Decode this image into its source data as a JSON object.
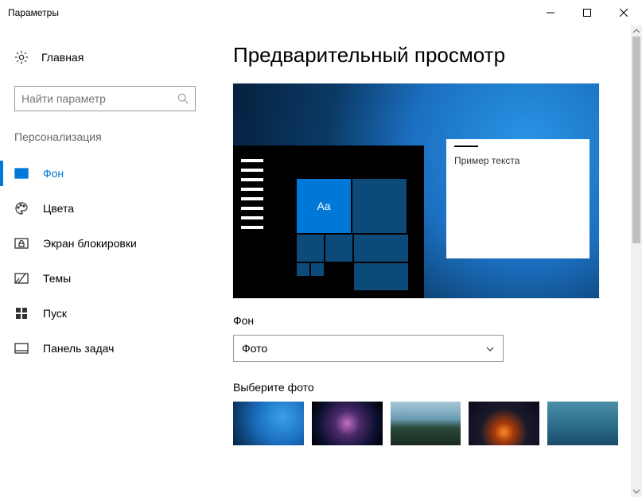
{
  "titlebar": {
    "title": "Параметры"
  },
  "sidebar": {
    "home": "Главная",
    "search_placeholder": "Найти параметр",
    "category": "Персонализация",
    "items": [
      {
        "label": "Фон",
        "icon": "picture-icon",
        "active": true
      },
      {
        "label": "Цвета",
        "icon": "palette-icon",
        "active": false
      },
      {
        "label": "Экран блокировки",
        "icon": "lockscreen-icon",
        "active": false
      },
      {
        "label": "Темы",
        "icon": "themes-icon",
        "active": false
      },
      {
        "label": "Пуск",
        "icon": "start-icon",
        "active": false
      },
      {
        "label": "Панель задач",
        "icon": "taskbar-icon",
        "active": false
      }
    ]
  },
  "content": {
    "heading": "Предварительный просмотр",
    "preview": {
      "tile_text": "Aa",
      "sample_text": "Пример текста"
    },
    "bg_label": "Фон",
    "bg_dropdown_value": "Фото",
    "choose_label": "Выберите фото"
  }
}
